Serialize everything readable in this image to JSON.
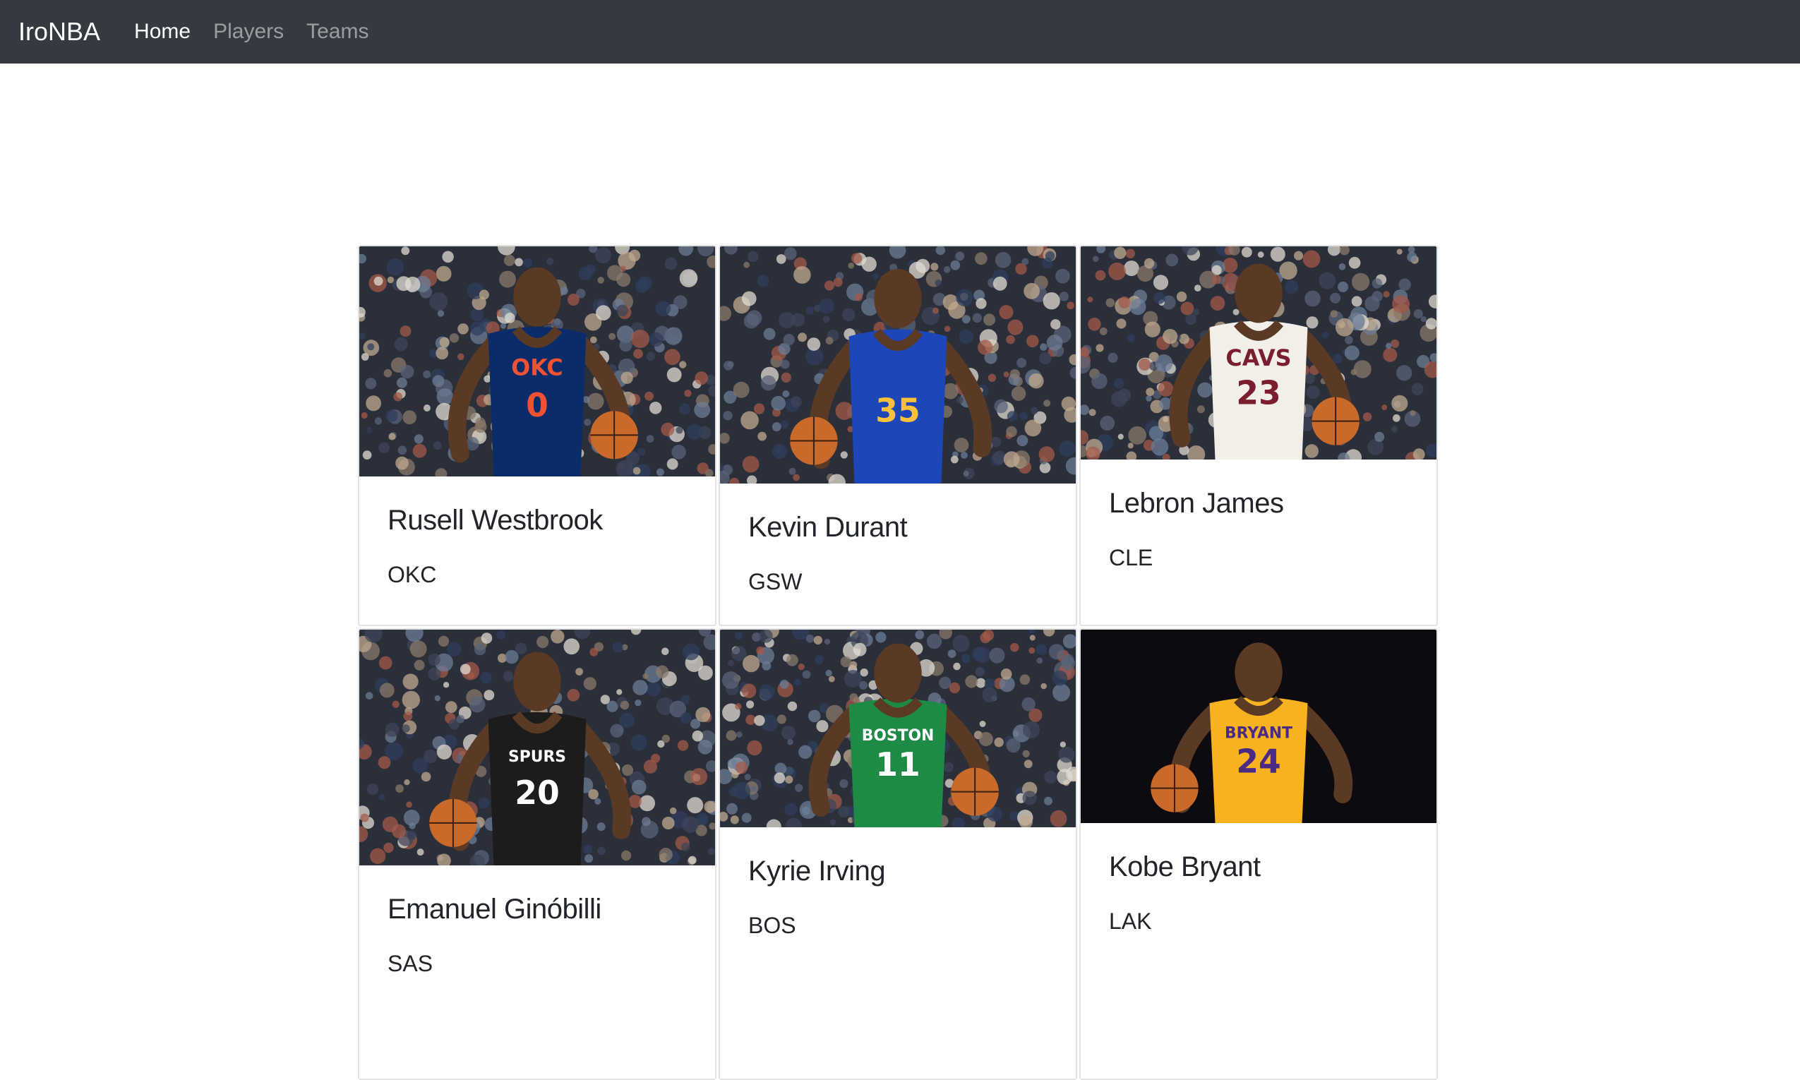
{
  "nav": {
    "brand": "IroNBA",
    "links": [
      {
        "label": "Home",
        "active": true
      },
      {
        "label": "Players",
        "active": false
      },
      {
        "label": "Teams",
        "active": false
      }
    ]
  },
  "players": [
    {
      "name": "Rusell Westbrook",
      "team": "OKC",
      "jersey_text": "OKC",
      "number": "0",
      "jersey_color": "#0b2c6b",
      "accent": "#f05133",
      "photo_h": 326
    },
    {
      "name": "Kevin Durant",
      "team": "GSW",
      "jersey_text": "",
      "number": "35",
      "jersey_color": "#1d47b8",
      "accent": "#f7c23a",
      "photo_h": 336
    },
    {
      "name": "Lebron James",
      "team": "CLE",
      "jersey_text": "CAVS",
      "number": "23",
      "jersey_color": "#f2efe9",
      "accent": "#7a1e2e",
      "photo_h": 302
    },
    {
      "name": "Emanuel Ginóbilli",
      "team": "SAS",
      "jersey_text": "SPURS",
      "number": "20",
      "jersey_color": "#1c1c1c",
      "accent": "#ffffff",
      "photo_h": 334
    },
    {
      "name": "Kyrie Irving",
      "team": "BOS",
      "jersey_text": "BOSTON",
      "number": "11",
      "jersey_color": "#1d8a46",
      "accent": "#ffffff",
      "photo_h": 280
    },
    {
      "name": "Kobe Bryant",
      "team": "LAK",
      "jersey_text": "BRYANT",
      "number": "24",
      "jersey_color": "#f7b21f",
      "accent": "#4b2a84",
      "photo_h": 274
    }
  ]
}
